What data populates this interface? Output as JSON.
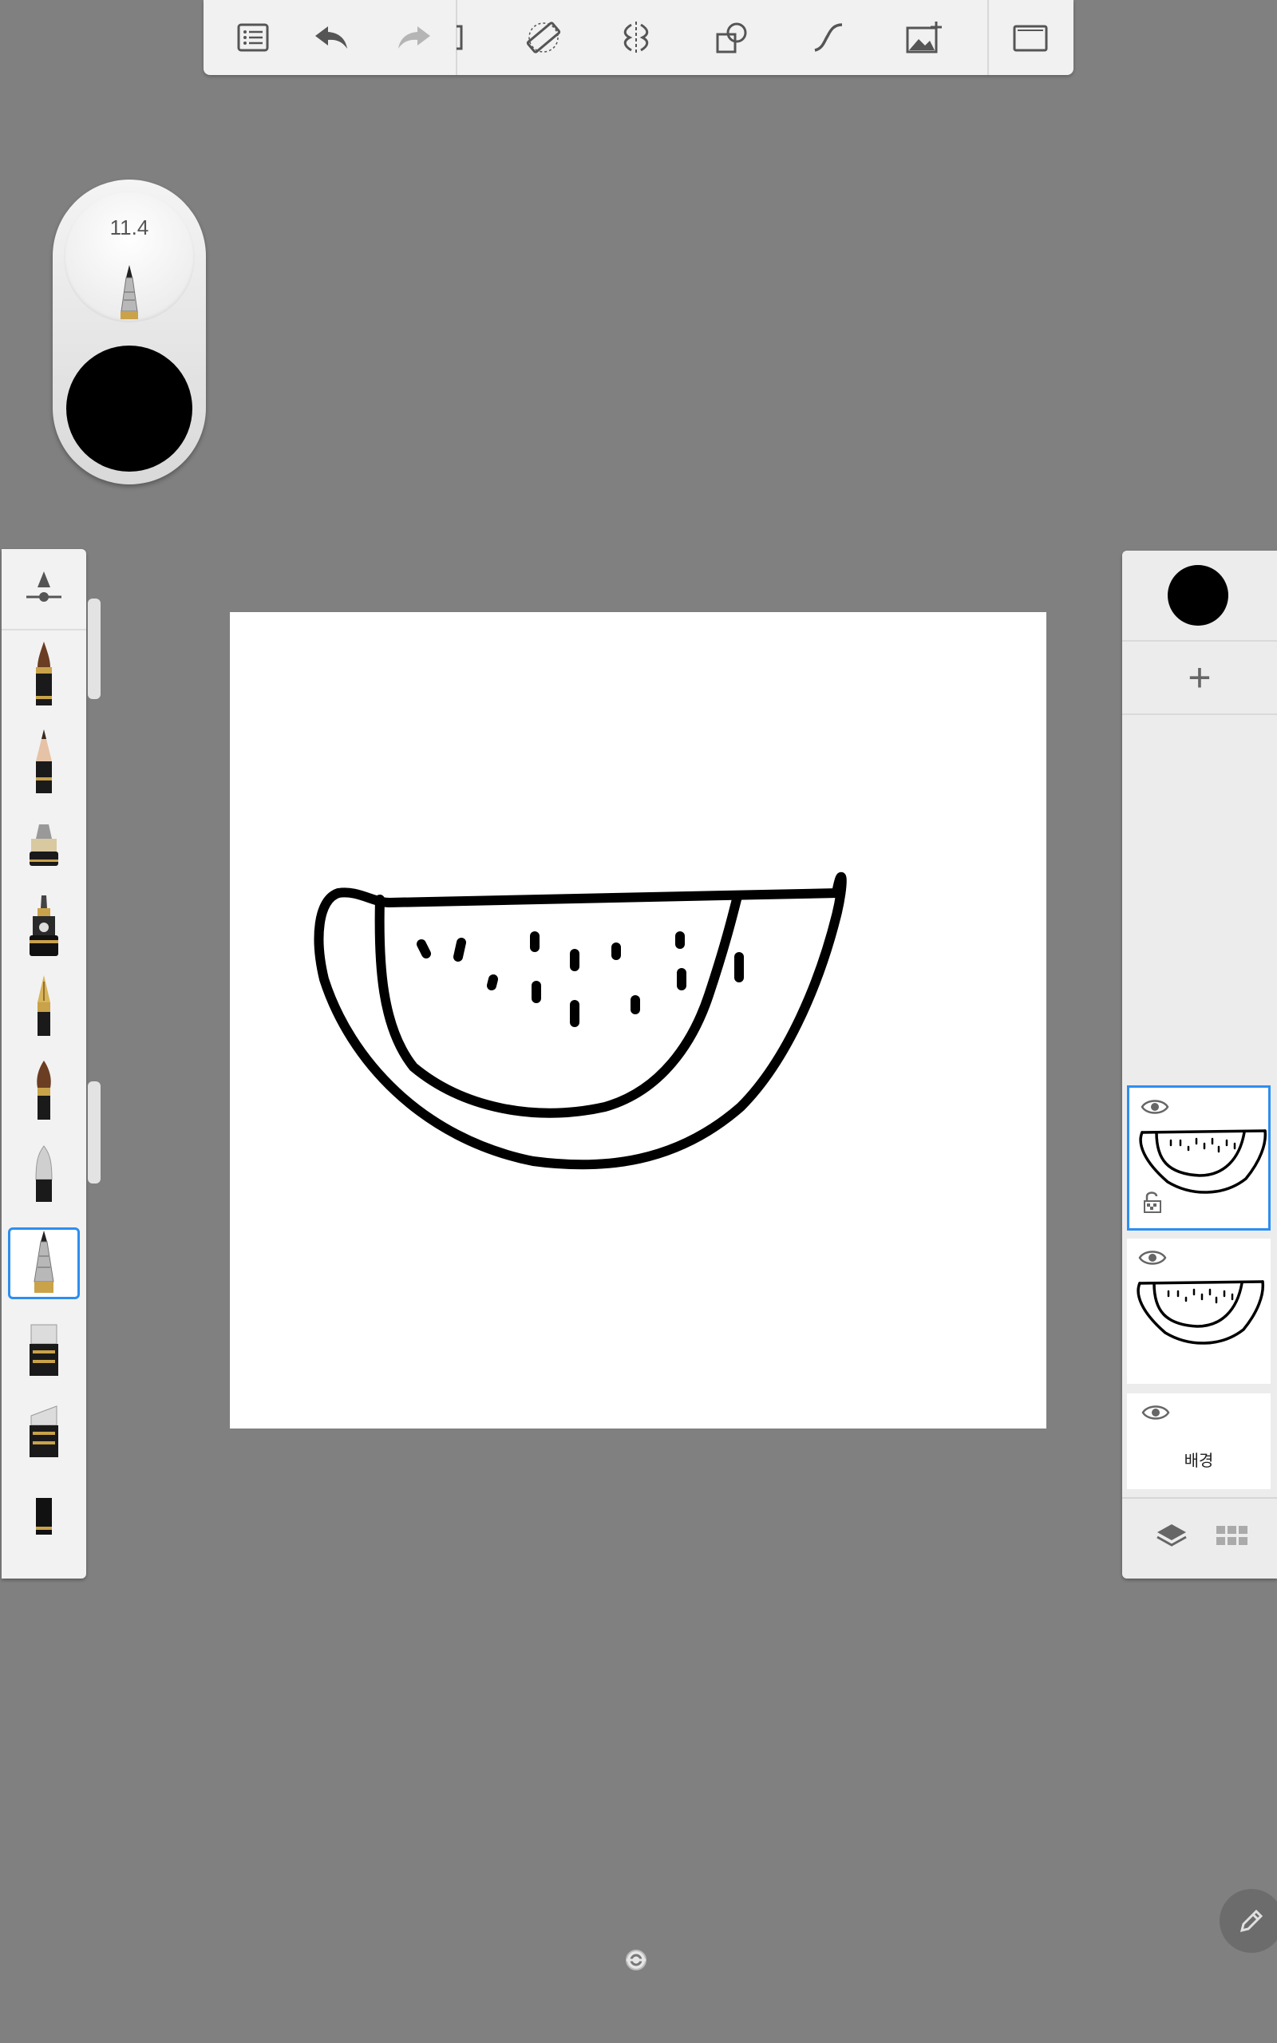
{
  "toolbar": {
    "buttons": [
      {
        "name": "list-icon"
      },
      {
        "name": "undo-icon"
      },
      {
        "name": "redo-icon"
      },
      {
        "name": "ruler-icon"
      },
      {
        "name": "symmetry-icon"
      },
      {
        "name": "shapes-icon"
      },
      {
        "name": "curve-icon"
      },
      {
        "name": "add-image-icon"
      },
      {
        "name": "fullscreen-icon"
      }
    ]
  },
  "puck": {
    "brush_size": "11.4",
    "color": "#000000"
  },
  "brush_dock": {
    "brushes": [
      "brush-settings",
      "ink-pen",
      "pencil",
      "marker",
      "technical-pen",
      "fountain-pen",
      "paint-brush",
      "airbrush",
      "ballpoint-pen",
      "eraser-hard",
      "eraser-soft",
      "eraser-block"
    ],
    "selected_index": 7
  },
  "layers": {
    "current_color": "#000000",
    "add_label": "+",
    "items": [
      {
        "name": "",
        "visible": true,
        "selected": true,
        "locked_icon": true
      },
      {
        "name": "",
        "visible": true,
        "selected": false
      },
      {
        "name": "배경",
        "visible": true,
        "selected": false
      }
    ]
  },
  "colors": {
    "background": "#808080",
    "accent": "#2d8ef0",
    "canvas": "#ffffff",
    "ink": "#000000"
  }
}
